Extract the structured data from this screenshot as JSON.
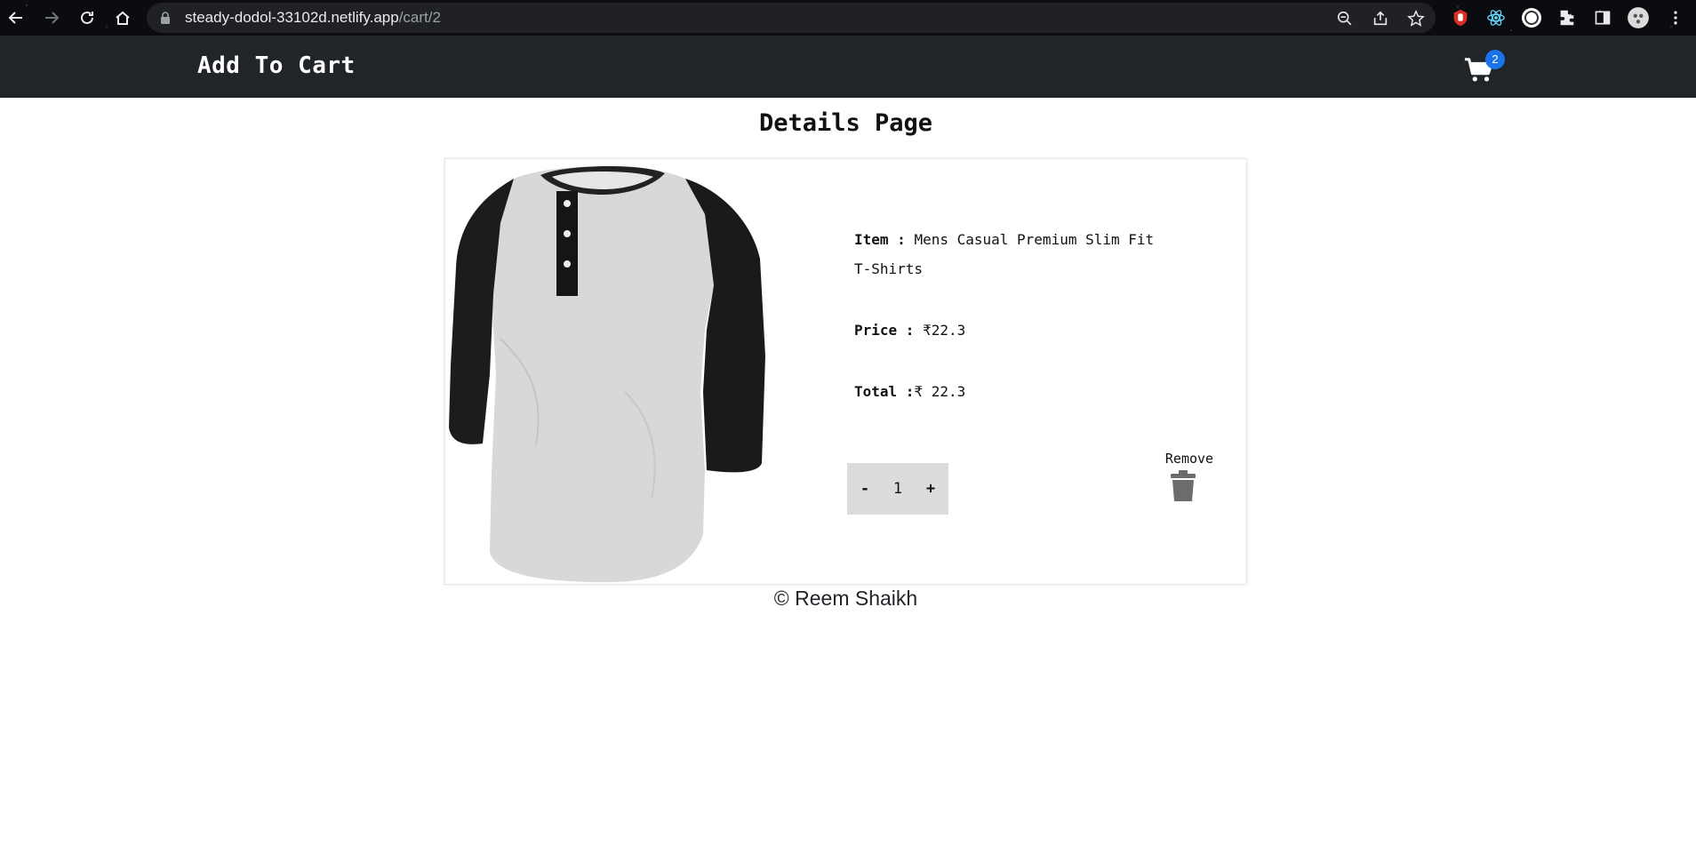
{
  "browser": {
    "url_host": "steady-dodol-33102d.netlify.app",
    "url_path": "/cart/2"
  },
  "navbar": {
    "brand": "Add To Cart",
    "cart_count": "2"
  },
  "page": {
    "title": "Details Page"
  },
  "product": {
    "item_label": "Item :",
    "item_name": "Mens Casual Premium Slim Fit T-Shirts",
    "price_label": "Price :",
    "price_value": "₹22.3",
    "total_label": "Total :",
    "total_value": "₹ 22.3",
    "quantity": "1",
    "decrement_label": "-",
    "increment_label": "+",
    "remove_label": "Remove",
    "image_icon": "raglan-henley-shirt-image"
  },
  "footer": {
    "text": "© Reem Shaikh"
  },
  "colors": {
    "navbar_bg": "#212529",
    "badge_bg": "#1a73e8",
    "qty_bg": "#dcdcdc",
    "trash": "#6c6c6c"
  }
}
